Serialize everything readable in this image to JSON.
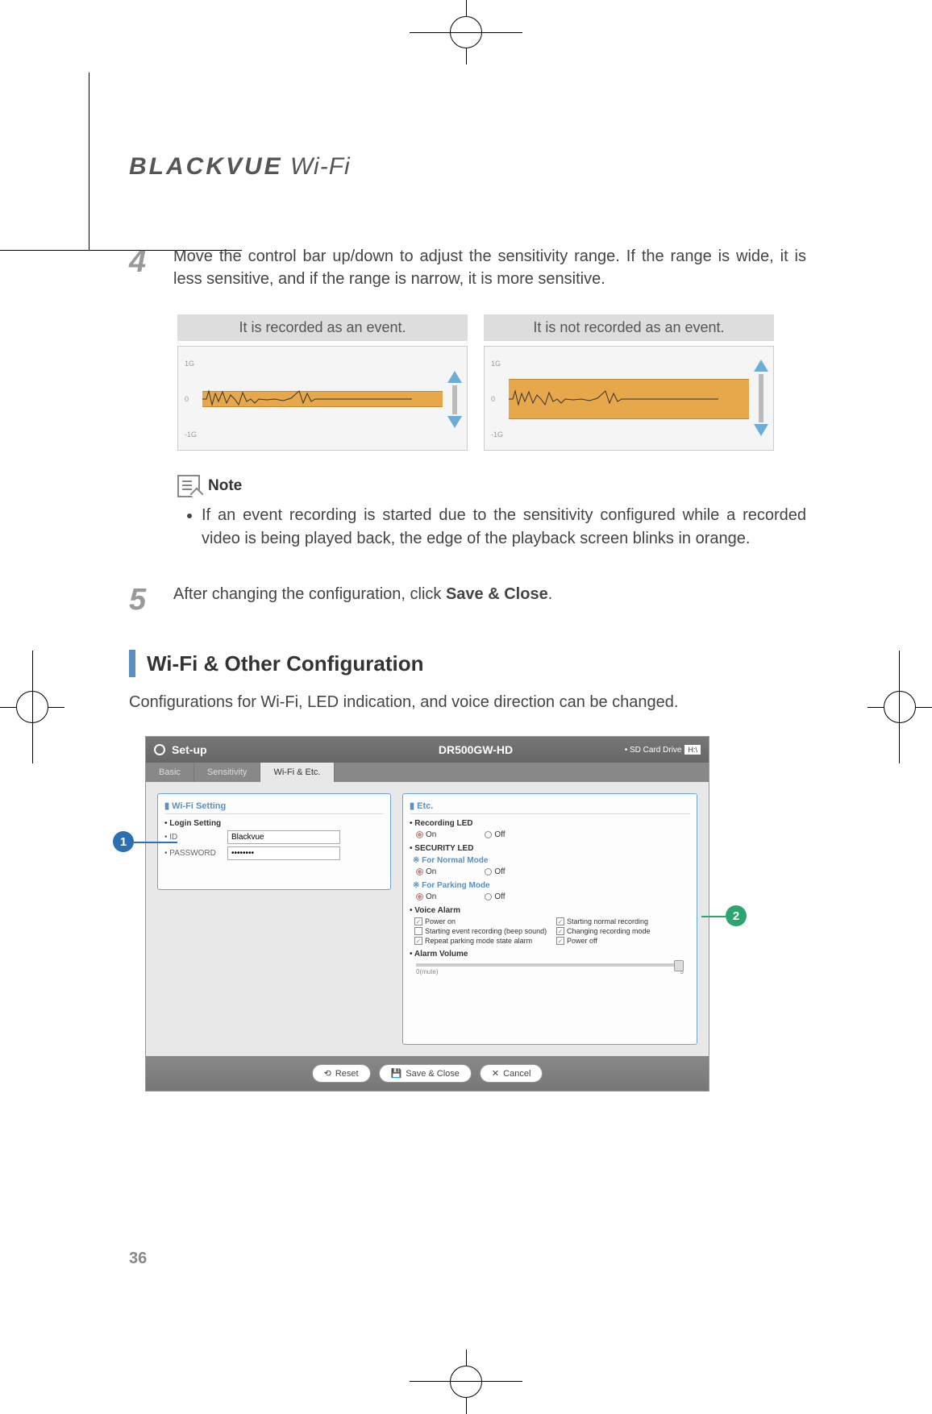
{
  "brand": {
    "black": "BLACKVUE",
    "suffix": " Wi-Fi"
  },
  "step4": {
    "num": "4",
    "text": "Move the control bar up/down to adjust the sensitivity range. If the range is wide, it is less sensitive, and if the range is narrow, it is more sensitive."
  },
  "gcharts": {
    "left_head": "It is recorded as an event.",
    "right_head": "It is not recorded as an event.",
    "yticks": {
      "top": "1G",
      "mid": "0",
      "bot": "-1G"
    }
  },
  "note": {
    "label": "Note",
    "item": "If an event recording is started due to the sensitivity configured while a recorded video is being played back, the edge of the playback screen blinks in orange."
  },
  "step5": {
    "num": "5",
    "text_a": "After changing the configuration, click ",
    "text_b": "Save & Close",
    "text_c": "."
  },
  "section": "Wi-Fi & Other Configuration",
  "desc": "Configurations for Wi-Fi, LED indication, and voice direction can be changed.",
  "setup": {
    "title": "Set-up",
    "model": "DR500GW-HD",
    "sd_label": "• SD Card Drive",
    "sd_value": "H:\\",
    "tabs": {
      "basic": "Basic",
      "sensitivity": "Sensitivity",
      "wifi": "Wi-Fi & Etc."
    },
    "wifi_panel": {
      "head": "Wi-Fi Setting",
      "login_h": "• Login Setting",
      "id_label": "• ID",
      "id_value": "Blackvue",
      "pw_label": "• PASSWORD",
      "pw_value": "••••••••"
    },
    "etc_panel": {
      "head": "Etc.",
      "rec_led": "• Recording LED",
      "on": "On",
      "off": "Off",
      "sec_led": "• SECURITY LED",
      "normal": "※ For Normal Mode",
      "parking": "※ For Parking Mode",
      "voice_alarm": "• Voice Alarm",
      "chk": {
        "power_on": "Power on",
        "starting_normal": "Starting normal recording",
        "starting_event": "Starting event recording (beep sound)",
        "changing_mode": "Changing recording mode",
        "repeat_parking": "Repeat parking mode state alarm",
        "power_off": "Power off"
      },
      "alarm_vol": "• Alarm Volume",
      "slider": {
        "lo": "0(mute)",
        "hi": "5"
      }
    },
    "buttons": {
      "reset": "Reset",
      "save": "Save & Close",
      "cancel": "Cancel"
    }
  },
  "callouts": {
    "c1": "1",
    "c2": "2"
  },
  "page_num": "36"
}
